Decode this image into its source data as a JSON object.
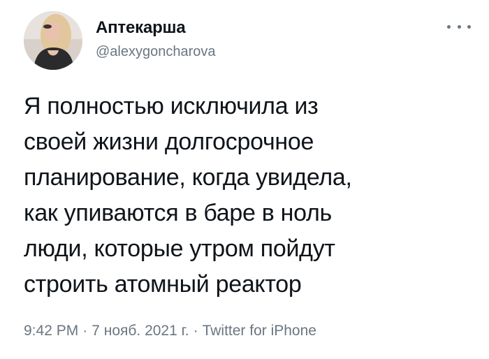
{
  "tweet": {
    "author": {
      "display_name": "Аптекарша",
      "handle": "@alexygoncharova",
      "avatar": "profile-photo"
    },
    "more_icon": "more-horizontal-icon",
    "text_lines": [
      "Я полностью исключила из",
      "своей жизни долгосрочное",
      "планирование, когда увидела,",
      "как упиваются в баре в ноль",
      "люди, которые утром пойдут",
      "строить атомный реактор"
    ],
    "meta": {
      "time": "9:42 PM",
      "separator": "·",
      "date": "7 нояб. 2021 г.",
      "source": "Twitter for iPhone"
    }
  },
  "colors": {
    "text": "#0f1419",
    "secondary": "#6a7681",
    "background": "#ffffff"
  }
}
